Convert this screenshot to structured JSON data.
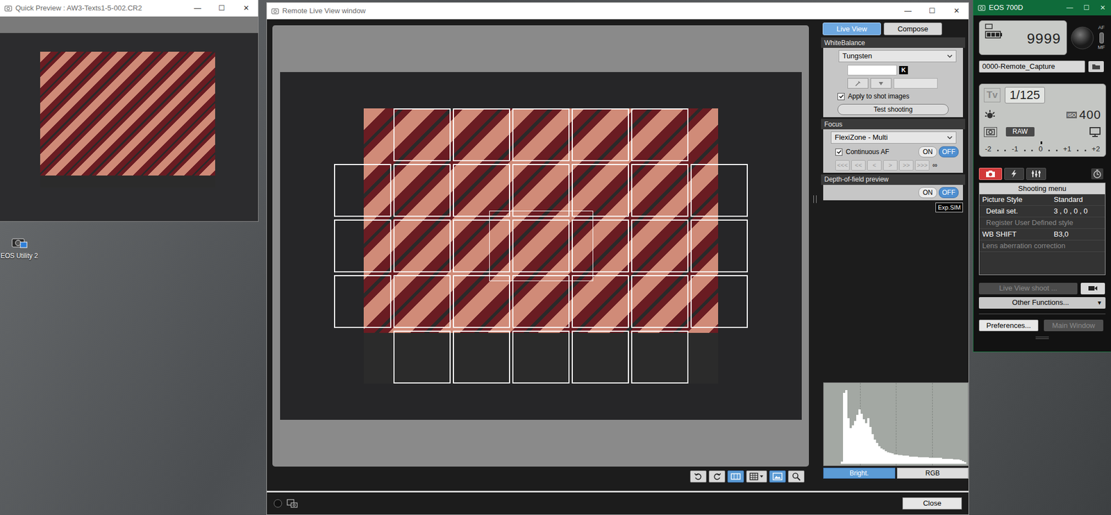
{
  "desktop": {
    "icons": [
      {
        "label": "EOS Utility 2"
      }
    ]
  },
  "quick_preview": {
    "title": "Quick Preview : AW3-Texts1-5-002.CR2",
    "controls": [
      "—",
      "☐",
      "✕"
    ]
  },
  "live_view": {
    "title": "Remote Live View window",
    "controls": [
      "—",
      "☐",
      "✕"
    ],
    "af_zones": {
      "rows": [
        5,
        7,
        7,
        7,
        5
      ]
    },
    "toolbar": [
      {
        "kind": "rotate-left",
        "selected": false
      },
      {
        "kind": "rotate-right",
        "selected": false
      },
      {
        "kind": "aspect",
        "selected": true
      },
      {
        "kind": "grid",
        "selected": false
      },
      {
        "kind": "frame",
        "selected": true
      },
      {
        "kind": "zoom",
        "selected": false
      }
    ],
    "tabs": [
      {
        "label": "Live View",
        "selected": true
      },
      {
        "label": "Compose",
        "selected": false
      }
    ],
    "white_balance": {
      "header": "WhiteBalance",
      "mode": "Tungsten",
      "kelvin_unit": "K",
      "apply": {
        "label": "Apply to shot images",
        "checked": true
      },
      "test_button": "Test shooting"
    },
    "focus": {
      "header": "Focus",
      "mode": "FlexiZone - Multi",
      "continuous_af": {
        "label": "Continuous AF",
        "checked": true
      },
      "toggle": [
        {
          "label": "ON",
          "selected": false
        },
        {
          "label": "OFF",
          "selected": true
        }
      ],
      "nav": [
        {
          "label": "<<<",
          "disabled": true
        },
        {
          "label": "<<",
          "disabled": true
        },
        {
          "label": "<",
          "disabled": true
        },
        {
          "label": ">",
          "disabled": true
        },
        {
          "label": ">>",
          "disabled": true
        },
        {
          "label": ">>>",
          "disabled": true
        },
        {
          "label": "∞",
          "disabled": false
        }
      ]
    },
    "dof": {
      "header": "Depth-of-field preview",
      "toggle": [
        {
          "label": "ON",
          "selected": false
        },
        {
          "label": "OFF",
          "selected": true
        }
      ]
    },
    "exposure_badge": "Exp.SIM",
    "histogram": {
      "values": [
        0,
        0,
        0,
        0,
        0,
        0,
        0,
        3,
        96,
        100,
        62,
        48,
        52,
        58,
        66,
        74,
        68,
        60,
        55,
        62,
        50,
        40,
        33,
        28,
        24,
        21,
        19,
        17,
        16,
        15,
        14,
        13,
        13,
        12,
        12,
        11,
        11,
        11,
        10,
        10,
        10,
        10,
        9,
        9,
        9,
        9,
        9,
        8,
        8,
        8,
        8,
        8,
        8,
        7,
        7,
        7,
        7,
        7,
        6,
        6,
        6,
        5,
        4,
        2
      ],
      "modes": [
        {
          "label": "Bright.",
          "selected": true
        },
        {
          "label": "RGB",
          "selected": false
        }
      ]
    },
    "close_button": "Close"
  },
  "camera": {
    "title": "EOS 700D",
    "controls": [
      "—",
      "☐",
      "✕"
    ],
    "battery_level": 1,
    "shots": "9999",
    "focus_switch": [
      "AF",
      "MF"
    ],
    "folder": "0000-Remote_Capture",
    "mode": "Tv",
    "shutter": "1/125",
    "iso_label": "ISO",
    "iso": "400",
    "quality": "RAW",
    "exposure_ticks": [
      {
        "label": "-2",
        "selected": false
      },
      {
        "label": "-1",
        "selected": false
      },
      {
        "label": "0",
        "selected": true
      },
      {
        "label": "+1",
        "selected": false
      },
      {
        "label": "+2",
        "selected": false
      }
    ],
    "tabs": [
      {
        "kind": "camera",
        "selected": true
      },
      {
        "kind": "flash",
        "selected": false
      },
      {
        "kind": "tools",
        "selected": false
      }
    ],
    "menu": {
      "header": "Shooting menu",
      "rows": [
        {
          "label": "Picture Style",
          "value": "Standard",
          "kind": "item",
          "disabled": false
        },
        {
          "label": "Detail set.",
          "value": "3 , 0 , 0 , 0",
          "kind": "sub",
          "disabled": false
        },
        {
          "label": "Register User Defined style",
          "value": "",
          "kind": "sub",
          "disabled": true
        },
        {
          "label": "WB SHIFT",
          "value": "B3,0",
          "kind": "item",
          "disabled": false
        },
        {
          "label": "Lens aberration correction",
          "value": "",
          "kind": "item",
          "disabled": true
        }
      ]
    },
    "live_view_shoot": {
      "label": "Live View shoot ...",
      "disabled": true
    },
    "other_functions": {
      "label": "Other Functions...",
      "arrow": "▾"
    },
    "preferences": "Preferences...",
    "main_window": {
      "label": "Main Window",
      "disabled": true
    }
  }
}
